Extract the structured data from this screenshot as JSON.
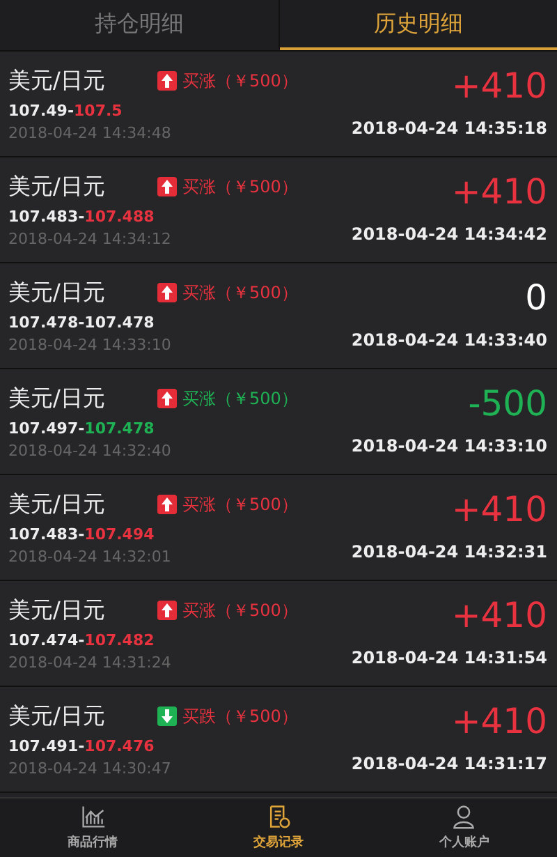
{
  "tabs": [
    {
      "label": "持仓明细",
      "selected": false
    },
    {
      "label": "历史明细",
      "selected": true
    }
  ],
  "trades": [
    {
      "pair": "美元/日元",
      "kind": "up",
      "order": {
        "text": "买涨（￥500）",
        "color": "#e8323f"
      },
      "open_price": "107.49",
      "separator": "-",
      "close_price": {
        "text": "107.5",
        "color": "#e8323f"
      },
      "open_time": "2018-04-24 14:34:48",
      "profit": {
        "text": "+410",
        "color": "#e8323f"
      },
      "close_time": "2018-04-24 14:35:18"
    },
    {
      "pair": "美元/日元",
      "kind": "up",
      "order": {
        "text": "买涨（￥500）",
        "color": "#e8323f"
      },
      "open_price": "107.483",
      "separator": "-",
      "close_price": {
        "text": "107.488",
        "color": "#e8323f"
      },
      "open_time": "2018-04-24 14:34:12",
      "profit": {
        "text": "+410",
        "color": "#e8323f"
      },
      "close_time": "2018-04-24 14:34:42"
    },
    {
      "pair": "美元/日元",
      "kind": "up",
      "order": {
        "text": "买涨（￥500）",
        "color": "#e8323f"
      },
      "open_price": "107.478",
      "separator": "-",
      "close_price": {
        "text": "107.478",
        "color": "#eeeeee"
      },
      "open_time": "2018-04-24 14:33:10",
      "profit": {
        "text": "0",
        "color": "#ffffff"
      },
      "close_time": "2018-04-24 14:33:40"
    },
    {
      "pair": "美元/日元",
      "kind": "up",
      "order": {
        "text": "买涨（￥500）",
        "color": "#1fb255"
      },
      "open_price": "107.497",
      "separator": "-",
      "close_price": {
        "text": "107.478",
        "color": "#1fb255"
      },
      "open_time": "2018-04-24 14:32:40",
      "profit": {
        "text": "-500",
        "color": "#1fb255"
      },
      "close_time": "2018-04-24 14:33:10"
    },
    {
      "pair": "美元/日元",
      "kind": "up",
      "order": {
        "text": "买涨（￥500）",
        "color": "#e8323f"
      },
      "open_price": "107.483",
      "separator": "-",
      "close_price": {
        "text": "107.494",
        "color": "#e8323f"
      },
      "open_time": "2018-04-24 14:32:01",
      "profit": {
        "text": "+410",
        "color": "#e8323f"
      },
      "close_time": "2018-04-24 14:32:31"
    },
    {
      "pair": "美元/日元",
      "kind": "up",
      "order": {
        "text": "买涨（￥500）",
        "color": "#e8323f"
      },
      "open_price": "107.474",
      "separator": "-",
      "close_price": {
        "text": "107.482",
        "color": "#e8323f"
      },
      "open_time": "2018-04-24 14:31:24",
      "profit": {
        "text": "+410",
        "color": "#e8323f"
      },
      "close_time": "2018-04-24 14:31:54"
    },
    {
      "pair": "美元/日元",
      "kind": "down",
      "order": {
        "text": "买跌（￥500）",
        "color": "#e8323f"
      },
      "open_price": "107.491",
      "separator": "-",
      "close_price": {
        "text": "107.476",
        "color": "#e8323f"
      },
      "open_time": "2018-04-24 14:30:47",
      "profit": {
        "text": "+410",
        "color": "#e8323f"
      },
      "close_time": "2018-04-24 14:31:17"
    }
  ],
  "nav": [
    {
      "label": "商品行情",
      "kind": "chart",
      "selected": false
    },
    {
      "label": "交易记录",
      "kind": "records",
      "selected": true
    },
    {
      "label": "个人账户",
      "kind": "person",
      "selected": false
    }
  ]
}
